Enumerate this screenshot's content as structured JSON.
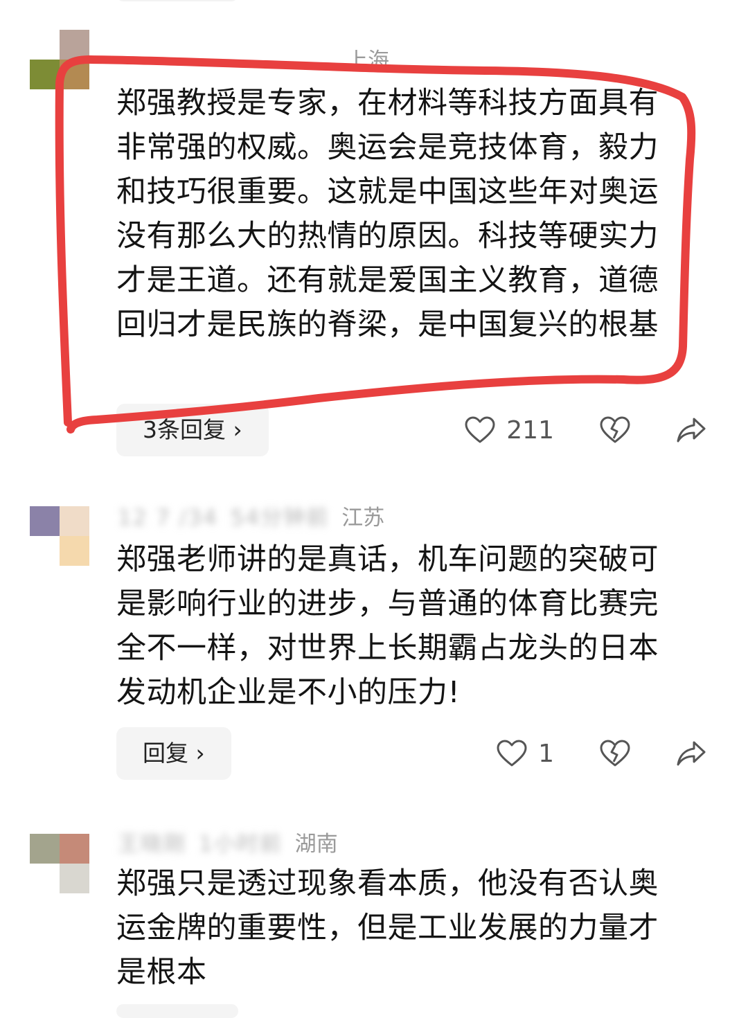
{
  "comments": [
    {
      "location": "上海",
      "text": "郑强教授是专家，在材料等科技方面具有非常强的权威。奥运会是竞技体育，毅力和技巧很重要。这就是中国这些年对奥运没有那么大的热情的原因。科技等硬实力才是王道。还有就是爱国主义教育，道德回归才是民族的脊梁，是中国复兴的根基",
      "reply_label": "3条回复 ›",
      "likes": "211"
    },
    {
      "author_blurred": "12 7 /34",
      "time_blurred": "54分钟前",
      "location": "江苏",
      "text": "郑强老师讲的是真话，机车问题的突破可是影响行业的进步，与普通的体育比赛完全不一样，对世界上长期霸占龙头的日本发动机企业是不小的压力!",
      "reply_label": "回复 ›",
      "likes": "1"
    },
    {
      "author_blurred": "王晓刚",
      "time_blurred": "1小时前",
      "location": "湖南",
      "text": "郑强只是透过现象看本质，他没有否认奥运金牌的重要性，但是工业发展的力量才是根本"
    }
  ],
  "icons": {
    "like": "heart-outline-icon",
    "dislike": "broken-heart-icon",
    "share": "share-arrow-icon"
  },
  "colors": {
    "annotation": "#e8403f",
    "meta_text": "#9a9a9a",
    "reply_bg": "#f4f4f4"
  }
}
